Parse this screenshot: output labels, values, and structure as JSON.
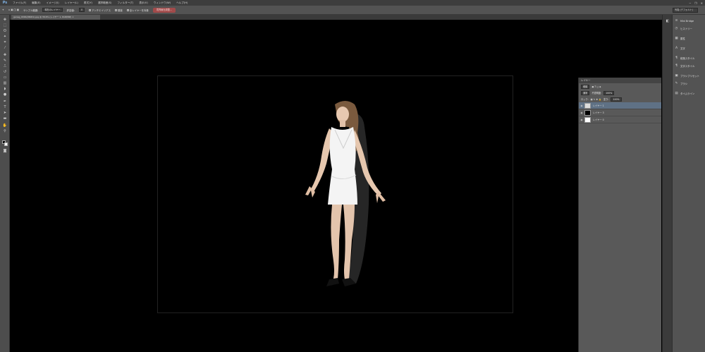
{
  "app": {
    "logo": "Ps"
  },
  "menu": [
    "ファイル(F)",
    "編集(E)",
    "イメージ(I)",
    "レイヤー(L)",
    "書式(Y)",
    "選択範囲(S)",
    "フィルター(T)",
    "表示(V)",
    "ウィンドウ(W)",
    "ヘルプ(H)"
  ],
  "window_controls": {
    "minimize": "─",
    "restore": "❐",
    "close": "✕"
  },
  "options": {
    "mode_label": "サンプル範囲:",
    "mode_value": "現在のレイヤー",
    "tolerance_label": "許容値:",
    "tolerance_value": "0",
    "antialias": "アンチエイリアス",
    "contiguous": "隣接",
    "all_layers": "全レイヤーを対象",
    "refine_edge": "境界線を調整...",
    "workspace": "写真 (デフォルト)"
  },
  "document": {
    "tab_title": "ganag_009b(06061).jpg @ 36.6% (レイヤー 1, RGB/8#) ×"
  },
  "layers": {
    "title": "レイヤー",
    "kind_filter": "種類",
    "blend_mode": "通常",
    "opacity_label": "不透明度:",
    "opacity_value": "100%",
    "lock_label": "ロック:",
    "fill_label": "塗り:",
    "fill_value": "100%",
    "items": [
      {
        "name": "レイヤー 1",
        "thumb": "#dcdcdc",
        "active": true
      },
      {
        "name": "レイヤー 3",
        "thumb": "#000000",
        "active": false
      },
      {
        "name": "レイヤー 0",
        "thumb": "#ffffff",
        "active": false
      }
    ]
  },
  "dock": [
    {
      "icon": "≡",
      "label": "Mini Bridge"
    },
    {
      "icon": "◷",
      "label": "ヒストリー"
    },
    {
      "icon": "▦",
      "label": "属性"
    },
    {
      "icon": "A",
      "label": "文字"
    },
    {
      "icon": "¶",
      "label": "段落スタイル"
    },
    {
      "icon": "¶",
      "label": "文字スタイル"
    },
    {
      "icon": "▣",
      "label": "ブラシプリセット"
    },
    {
      "icon": "✎",
      "label": "ブラシ"
    },
    {
      "icon": "▤",
      "label": "タイムライン"
    }
  ],
  "colors": {
    "app_bg": "#000000",
    "menubar": "#3d3d3d",
    "panel": "#535353",
    "active_layer": "#5f7185",
    "refine_button": "#a24a4a"
  }
}
